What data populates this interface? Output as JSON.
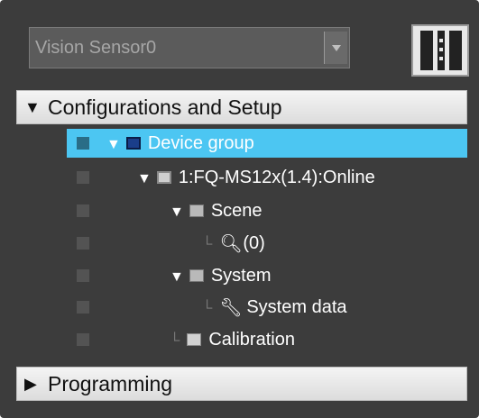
{
  "device_select": {
    "value": "Vision Sensor0"
  },
  "sections": {
    "config": {
      "label": "Configurations and Setup",
      "expanded_glyph": "▼"
    },
    "programming": {
      "label": "Programming",
      "collapsed_glyph": "▶"
    }
  },
  "tree": {
    "device_group": "Device group",
    "device": "1:FQ-MS12x(1.4):Online",
    "scene": "Scene",
    "scene_item": "(0)",
    "system": "System",
    "system_data": "System data",
    "calibration": "Calibration"
  },
  "colors": {
    "panel_bg": "#3c3c3c",
    "selection": "#4cc6f2"
  },
  "icons": {
    "device_group": "device-group-icon",
    "device": "computer-icon",
    "scene": "scene-icon",
    "scene_item": "magnifier-icon",
    "system": "system-icon",
    "system_data": "wrench-icon",
    "calibration": "folder-icon"
  }
}
